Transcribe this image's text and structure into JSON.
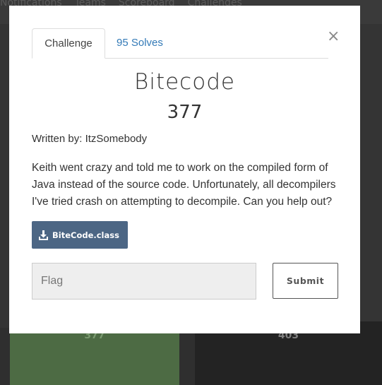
{
  "background": {
    "nav_items": [
      "Notifications",
      "Teams",
      "Scoreboard",
      "Challenges"
    ],
    "card_values": [
      "377",
      "403"
    ]
  },
  "modal": {
    "tabs": [
      {
        "label": "Challenge",
        "active": true
      },
      {
        "label": "95 Solves",
        "active": false
      }
    ],
    "close_label": "×",
    "title": "Bitecode",
    "points": "377",
    "author": "Written by: ItzSomebody",
    "description": "Keith went crazy and told me to work on the compiled form of Java instead of the source code. Unfortunately, all decompilers I've tried crash on attempting to decompile. Can you help out?",
    "file_label": "BiteCode.class",
    "file_icon": "download-icon",
    "flag_placeholder": "Flag",
    "flag_value": "",
    "submit_label": "Submit"
  },
  "colors": {
    "file_button": "#4c6684",
    "link": "#337ab7",
    "backdrop": "#2f2f2f"
  }
}
